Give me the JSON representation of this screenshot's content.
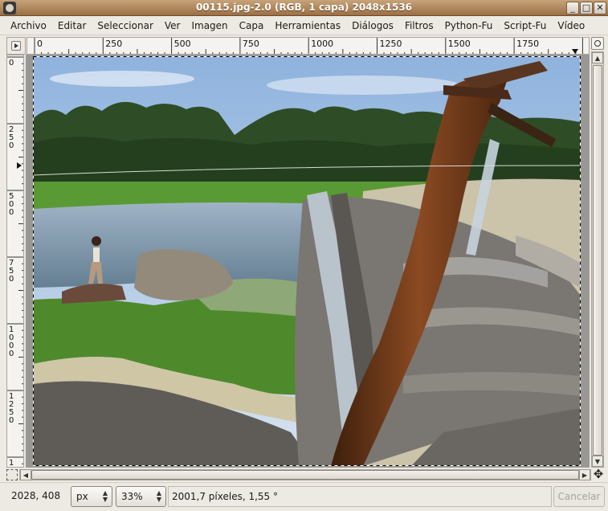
{
  "window": {
    "title": "00115.jpg-2.0 (RGB, 1 capa) 2048x1536",
    "buttons": {
      "minimize": "_",
      "maximize": "□",
      "close": "✕"
    }
  },
  "menu": {
    "items": [
      "Archivo",
      "Editar",
      "Seleccionar",
      "Ver",
      "Imagen",
      "Capa",
      "Herramientas",
      "Diálogos",
      "Filtros",
      "Python-Fu",
      "Script-Fu",
      "Vídeo"
    ]
  },
  "ruler": {
    "horizontal_labels": [
      "0",
      "250",
      "500",
      "750",
      "1000",
      "1250",
      "1500",
      "1750"
    ],
    "vertical_labels": [
      "0",
      "250",
      "500",
      "750",
      "1000",
      "1250",
      "1"
    ]
  },
  "canvas": {
    "description_icon": "image-canvas",
    "colors": {
      "sky": "#bcd2ec",
      "trees": "#2b4a24",
      "grass": "#4e8a2c",
      "water": "#7f9bb4",
      "sand": "#c9c0a6",
      "rock": "#6e6a62",
      "rust": "#6a3a1c",
      "wood": "#8a8a88"
    }
  },
  "status": {
    "coordinates": "2028, 408",
    "unit": "px",
    "zoom": "33%",
    "message": "2001,7 píxeles, 1,55 °",
    "cancel_label": "Cancelar"
  }
}
